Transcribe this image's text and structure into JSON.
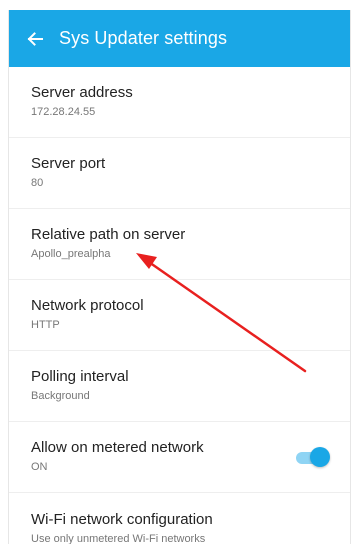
{
  "header": {
    "title": "Sys Updater settings",
    "back_icon": "arrow-left-icon",
    "color": "#1aa7e6"
  },
  "settings": [
    {
      "title": "Server address",
      "summary": "172.28.24.55"
    },
    {
      "title": "Server port",
      "summary": "80"
    },
    {
      "title": "Relative path on server",
      "summary": "Apollo_prealpha"
    },
    {
      "title": "Network protocol",
      "summary": "HTTP"
    },
    {
      "title": "Polling interval",
      "summary": "Background"
    },
    {
      "title": "Allow on metered network",
      "summary": "ON",
      "toggle": true
    },
    {
      "title": "Wi-Fi network configuration",
      "summary": "Use only unmetered Wi-Fi networks"
    }
  ],
  "annotation": {
    "type": "arrow",
    "color": "#e8201f",
    "points_to": "Relative path on server"
  }
}
